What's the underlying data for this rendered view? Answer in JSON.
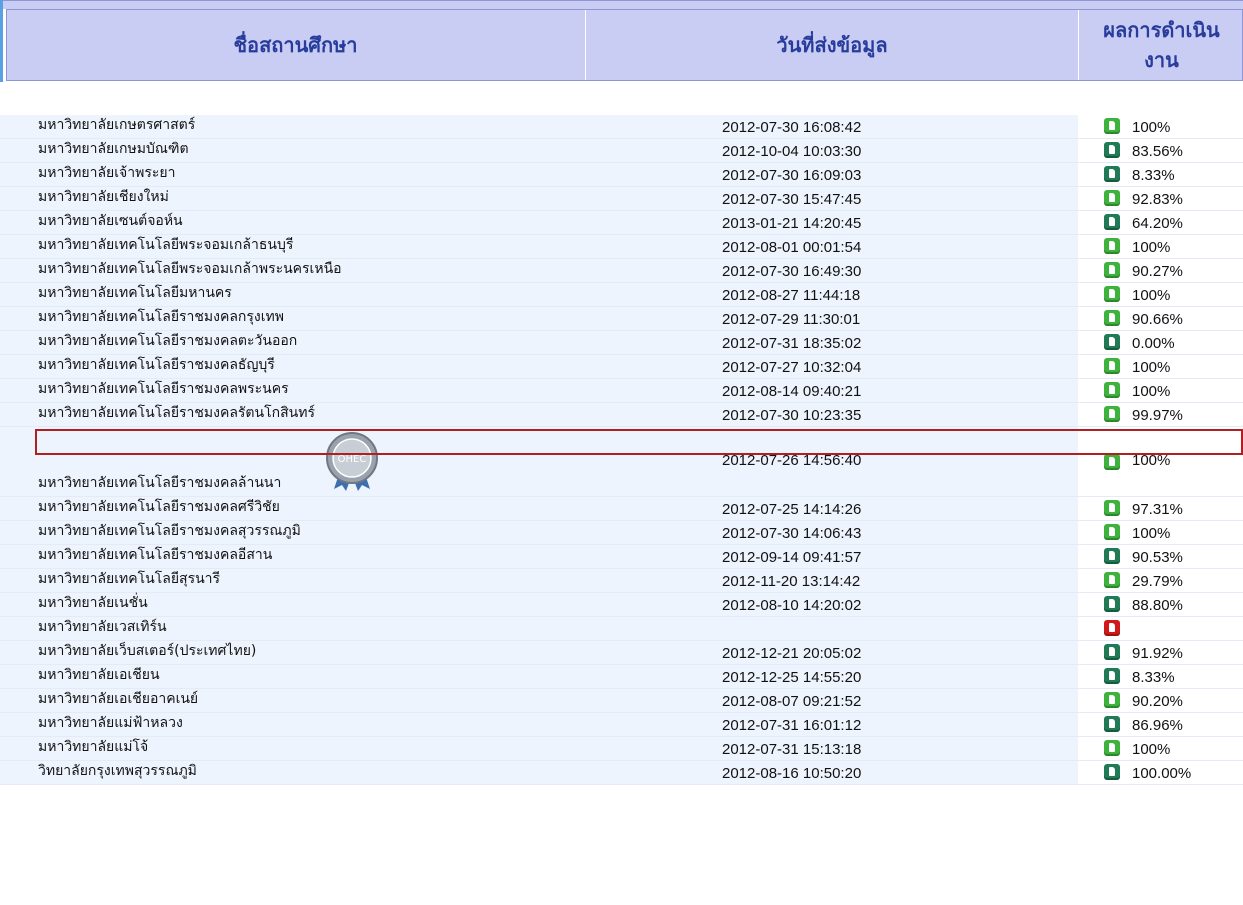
{
  "table": {
    "headers": {
      "institution": "ชื่อสถานศึกษา",
      "send_date": "วันที่ส่งข้อมูล",
      "result": "ผลการดำเนินงาน"
    },
    "rows": [
      {
        "name": "มหาวิทยาลัยเกษตรศาสตร์",
        "date": "2012-07-30 16:08:42",
        "status": "green",
        "pct": "100%"
      },
      {
        "name": "มหาวิทยาลัยเกษมบัณฑิต",
        "date": "2012-10-04 10:03:30",
        "status": "teal",
        "pct": "83.56%"
      },
      {
        "name": "มหาวิทยาลัยเจ้าพระยา",
        "date": "2012-07-30 16:09:03",
        "status": "teal",
        "pct": "8.33%"
      },
      {
        "name": "มหาวิทยาลัยเชียงใหม่",
        "date": "2012-07-30 15:47:45",
        "status": "green",
        "pct": "92.83%"
      },
      {
        "name": "มหาวิทยาลัยเซนต์จอห์น",
        "date": "2013-01-21 14:20:45",
        "status": "teal",
        "pct": "64.20%"
      },
      {
        "name": "มหาวิทยาลัยเทคโนโลยีพระจอมเกล้าธนบุรี",
        "date": "2012-08-01 00:01:54",
        "status": "green",
        "pct": "100%"
      },
      {
        "name": "มหาวิทยาลัยเทคโนโลยีพระจอมเกล้าพระนครเหนือ",
        "date": "2012-07-30 16:49:30",
        "status": "green",
        "pct": "90.27%"
      },
      {
        "name": "มหาวิทยาลัยเทคโนโลยีมหานคร",
        "date": "2012-08-27 11:44:18",
        "status": "green",
        "pct": "100%"
      },
      {
        "name": "มหาวิทยาลัยเทคโนโลยีราชมงคลกรุงเทพ",
        "date": "2012-07-29 11:30:01",
        "status": "green",
        "pct": "90.66%"
      },
      {
        "name": "มหาวิทยาลัยเทคโนโลยีราชมงคลตะวันออก",
        "date": "2012-07-31 18:35:02",
        "status": "teal",
        "pct": "0.00%"
      },
      {
        "name": "มหาวิทยาลัยเทคโนโลยีราชมงคลธัญบุรี",
        "date": "2012-07-27 10:32:04",
        "status": "green",
        "pct": "100%"
      },
      {
        "name": "มหาวิทยาลัยเทคโนโลยีราชมงคลพระนคร",
        "date": "2012-08-14 09:40:21",
        "status": "green",
        "pct": "100%"
      },
      {
        "name": "มหาวิทยาลัยเทคโนโลยีราชมงคลรัตนโกสินทร์",
        "date": "2012-07-30 10:23:35",
        "status": "green",
        "pct": "99.97%"
      },
      {
        "name": "มหาวิทยาลัยเทคโนโลยีราชมงคลล้านนา",
        "date": "2012-07-26 14:56:40",
        "status": "green",
        "pct": "100%",
        "seal": "OHEC"
      },
      {
        "name": "มหาวิทยาลัยเทคโนโลยีราชมงคลศรีวิชัย",
        "date": "2012-07-25 14:14:26",
        "status": "green",
        "pct": "97.31%"
      },
      {
        "name": "มหาวิทยาลัยเทคโนโลยีราชมงคลสุวรรณภูมิ",
        "date": "2012-07-30 14:06:43",
        "status": "green",
        "pct": "100%"
      },
      {
        "name": "มหาวิทยาลัยเทคโนโลยีราชมงคลอีสาน",
        "date": "2012-09-14 09:41:57",
        "status": "teal",
        "pct": "90.53%"
      },
      {
        "name": "มหาวิทยาลัยเทคโนโลยีสุรนารี",
        "date": "2012-11-20 13:14:42",
        "status": "green",
        "pct": "29.79%"
      },
      {
        "name": "มหาวิทยาลัยเนชั่น",
        "date": "2012-08-10 14:20:02",
        "status": "teal",
        "pct": "88.80%"
      },
      {
        "name": "มหาวิทยาลัยเวสเทิร์น",
        "date": "",
        "status": "red",
        "pct": ""
      },
      {
        "name": "มหาวิทยาลัยเว็บสเตอร์(ประเทศไทย)",
        "date": "2012-12-21 20:05:02",
        "status": "teal",
        "pct": "91.92%"
      },
      {
        "name": "มหาวิทยาลัยเอเชียน",
        "date": "2012-12-25 14:55:20",
        "status": "teal",
        "pct": "8.33%"
      },
      {
        "name": "มหาวิทยาลัยเอเชียอาคเนย์",
        "date": "2012-08-07 09:21:52",
        "status": "green",
        "pct": "90.20%"
      },
      {
        "name": "มหาวิทยาลัยแม่ฟ้าหลวง",
        "date": "2012-07-31 16:01:12",
        "status": "teal",
        "pct": "86.96%"
      },
      {
        "name": "มหาวิทยาลัยแม่โจ้",
        "date": "2012-07-31 15:13:18",
        "status": "green",
        "pct": "100%"
      },
      {
        "name": "วิทยาลัยกรุงเทพสุวรรณภูมิ",
        "date": "2012-08-16 10:50:20",
        "status": "teal",
        "pct": "100.00%"
      }
    ]
  },
  "colors": {
    "header_bg": "#c9cdf4",
    "header_text": "#283c9c",
    "row_bg": "#eef4fd",
    "highlight_border": "#b02020",
    "status_green": "#3db33d",
    "status_teal": "#1f7a55",
    "status_red": "#d01a1a"
  }
}
